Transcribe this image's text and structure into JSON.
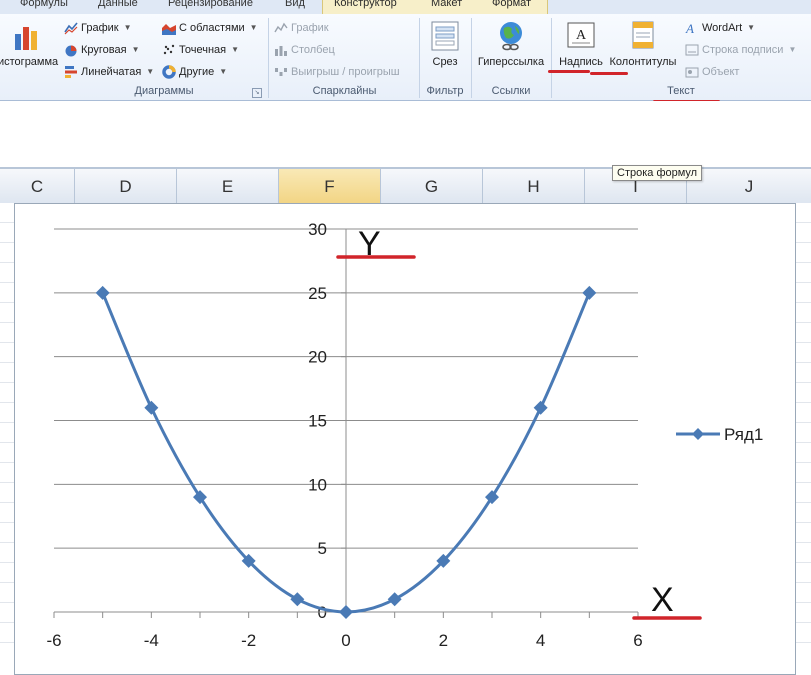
{
  "ribbon": {
    "tabs": [
      "Формулы",
      "Данные",
      "Рецензирование",
      "Вид",
      "Конструктор",
      "Макет",
      "Формат"
    ],
    "diagrams": {
      "histogram_label": "истограмма",
      "items": [
        {
          "label": "График",
          "dropdown": true
        },
        {
          "label": "С областями",
          "dropdown": true
        },
        {
          "label": "Круговая",
          "dropdown": true
        },
        {
          "label": "Точечная",
          "dropdown": true
        },
        {
          "label": "Линейчатая",
          "dropdown": true
        },
        {
          "label": "Другие",
          "dropdown": true
        }
      ],
      "group_label": "Диаграммы"
    },
    "sparklines": {
      "items": [
        "График",
        "Столбец",
        "Выигрыш / проигрыш"
      ],
      "group_label": "Спарклайны"
    },
    "filter": {
      "button": "Срез",
      "group_label": "Фильтр"
    },
    "links": {
      "button": "Гиперссылка",
      "group_label": "Ссылки"
    },
    "text": {
      "textbox": "Надпись",
      "header_footer": "Колонтитулы",
      "wordart": "WordArt",
      "signature_line": "Строка подписи",
      "object": "Объект",
      "group_label": "Текст"
    }
  },
  "tooltip": "Строка формул",
  "columns": [
    "C",
    "D",
    "E",
    "F",
    "G",
    "H",
    "I",
    "J"
  ],
  "active_column": "F",
  "annotations": {
    "y_mark": "Y",
    "x_mark": "X"
  },
  "colors": {
    "series": "#4a7ab5",
    "annotation_red": "#d1242a"
  },
  "chart_data": {
    "type": "scatter",
    "x": [
      -5,
      -4,
      -3,
      -2,
      -1,
      0,
      1,
      2,
      3,
      4,
      5
    ],
    "series": [
      {
        "name": "Ряд1",
        "values": [
          25,
          16,
          9,
          4,
          1,
          0,
          1,
          4,
          9,
          16,
          25
        ]
      }
    ],
    "xlim": [
      -6,
      6
    ],
    "ylim": [
      0,
      30
    ],
    "x_ticks": [
      "-6",
      "-4",
      "-2",
      "0",
      "2",
      "4",
      "6"
    ],
    "y_ticks": [
      "0",
      "5",
      "10",
      "15",
      "20",
      "25",
      "30"
    ],
    "smooth_lines": true,
    "markers": "diamond",
    "grid": "horizontal",
    "legend": "right"
  }
}
